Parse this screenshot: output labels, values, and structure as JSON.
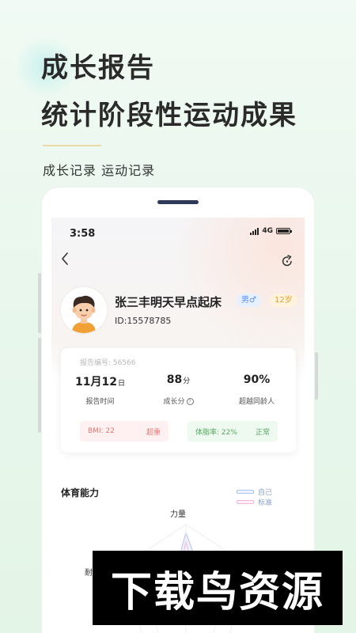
{
  "hero": {
    "title": "成长报告",
    "subtitle": "统计阶段性运动成果",
    "tags": "成长记录 运动记录"
  },
  "status_bar": {
    "time": "3:58",
    "network": "4G"
  },
  "profile": {
    "name": "张三丰明天早点起床",
    "id": "ID:15578785",
    "gender": "男♂",
    "age": "12岁"
  },
  "report": {
    "number": "报告编号: 56566",
    "stats": [
      {
        "value": "11月12",
        "unit": "日",
        "label": "报告时间"
      },
      {
        "value": "88",
        "unit": "分",
        "label": "成长分"
      },
      {
        "value": "90%",
        "unit": "",
        "label": "超越同龄人"
      }
    ],
    "bmi": {
      "label": "BMI: 22",
      "status": "超重"
    },
    "body_fat": {
      "label": "体脂率: 22%",
      "status": "正常"
    }
  },
  "fitness": {
    "title": "体育能力",
    "legend": [
      {
        "label": "自己",
        "color": "#a9c3f5"
      },
      {
        "label": "标准",
        "color": "#f2b6dc"
      }
    ],
    "axis_top": "力量",
    "axis_left": "耐"
  },
  "watermark": "下载鸟资源",
  "colors": {
    "accent_blue": "#5b8ff0",
    "accent_orange": "#e6a032",
    "warn_red": "#e67575",
    "ok_green": "#59a866"
  }
}
